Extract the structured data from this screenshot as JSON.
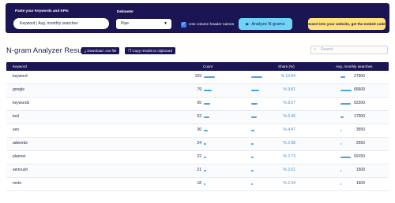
{
  "controls": {
    "keywords_label": "Paste your Keywords and KPIs",
    "keywords_value": "Keyword | Avg. monthly searches",
    "delimiter_label": "Delimeter",
    "delimiter_value": "Pipe",
    "header_checkbox_label": "Use column header names",
    "header_checkbox_checked": true,
    "analyze_label": "Analyze N-grams",
    "embed_label": "Insert into your website, get the embed code"
  },
  "results": {
    "title": "N-gram Analyzer Results",
    "download_label": "Download .csv file",
    "copy_label": "Copy results to clipboard",
    "search_placeholder": "Search"
  },
  "table": {
    "headers": {
      "keyword": "Keyword",
      "count": "Count",
      "share": "Share (%)",
      "volume": "Avg. monthly searches"
    },
    "rows": [
      {
        "keyword": "keyword",
        "count": "109",
        "share": "% 13.84",
        "volume": "27900",
        "count_frac": 1.0,
        "share_frac": 1.0,
        "volume_frac": 0.45
      },
      {
        "keyword": "google",
        "count": "79",
        "share": "% 9.81",
        "volume": "65600",
        "count_frac": 0.72,
        "share_frac": 0.71,
        "volume_frac": 1.0
      },
      {
        "keyword": "keywords",
        "count": "65",
        "share": "% 8.07",
        "volume": "62200",
        "count_frac": 0.6,
        "share_frac": 0.58,
        "volume_frac": 0.95
      },
      {
        "keyword": "tool",
        "count": "52",
        "share": "% 6.46",
        "volume": "17000",
        "count_frac": 0.48,
        "share_frac": 0.47,
        "volume_frac": 0.28
      },
      {
        "keyword": "seo",
        "count": "36",
        "share": "% 4.47",
        "volume": "3550",
        "count_frac": 0.33,
        "share_frac": 0.32,
        "volume_frac": 0.07
      },
      {
        "keyword": "adwords",
        "count": "24",
        "share": "% 2.98",
        "volume": "2550",
        "count_frac": 0.22,
        "share_frac": 0.22,
        "volume_frac": 0.05
      },
      {
        "keyword": "planner",
        "count": "22",
        "share": "% 2.73",
        "volume": "59150",
        "count_frac": 0.2,
        "share_frac": 0.2,
        "volume_frac": 0.9
      },
      {
        "keyword": "semrush",
        "count": "21",
        "share": "% 2.61",
        "volume": "1500",
        "count_frac": 0.19,
        "share_frac": 0.19,
        "volume_frac": 0.03
      },
      {
        "keyword": "moto",
        "count": "18",
        "share": "% 2.34",
        "volume": "1600",
        "count_frac": 0.17,
        "share_frac": 0.17,
        "volume_frac": 0.03
      }
    ]
  },
  "colors": {
    "navy": "#1b1653",
    "accent_blue": "#4aa3df",
    "cta_cyan": "#6fd3f3",
    "cta_yellow": "#ffe27a"
  }
}
